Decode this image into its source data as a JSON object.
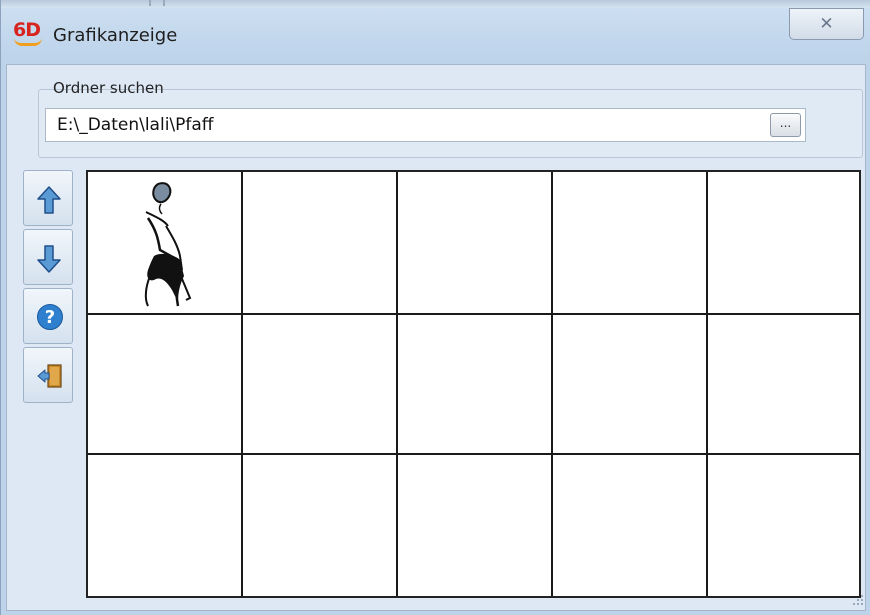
{
  "window": {
    "title": "Grafikanzeige",
    "logo_text": "6D",
    "close_glyph": "✕"
  },
  "folder_search": {
    "label": "Ordner suchen",
    "path_value": "E:\\_Daten\\lali\\Pfaff",
    "browse_label": "..."
  },
  "toolbar": {
    "buttons": [
      {
        "name": "arrow-up-icon"
      },
      {
        "name": "arrow-down-icon"
      },
      {
        "name": "help-icon"
      },
      {
        "name": "exit-door-icon"
      }
    ]
  },
  "grid": {
    "rows": 3,
    "columns": 5,
    "thumbnails": [
      {
        "row": 0,
        "col": 0,
        "icon": "fashion-figure-icon"
      }
    ]
  },
  "colors": {
    "arrow_fill": "#5b9bd5",
    "help_fill": "#2f7fcf",
    "door_fill": "#c98a2c",
    "logo_red": "#d8241e",
    "logo_orange": "#f0a020"
  }
}
